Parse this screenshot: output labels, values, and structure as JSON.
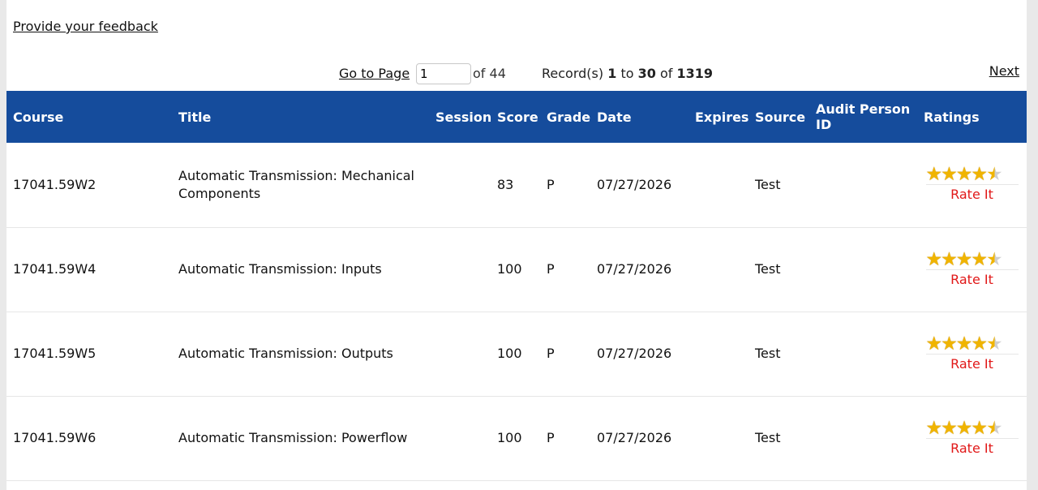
{
  "feedback_link": "Provide your feedback",
  "pager": {
    "goto_label": "Go to Page",
    "page_value": "1",
    "of_pages": "of 44",
    "records_prefix": "Record(s)",
    "records_start": "1",
    "records_to": "to",
    "records_end": "30",
    "records_of": "of",
    "records_total": "1319",
    "next_label": "Next"
  },
  "table": {
    "headers": [
      "Course",
      "Title",
      "Session",
      "Score",
      "Grade",
      "Date",
      "Expires",
      "Source",
      "Audit Person ID",
      "Ratings"
    ],
    "rows": [
      {
        "course": "17041.59W2",
        "title": "Automatic Transmission: Mechanical Components",
        "session": "",
        "score": "83",
        "grade": "P",
        "date": "07/27/2026",
        "expires": "",
        "source": "Test",
        "audit": "",
        "rating": 4.5,
        "rate_label": "Rate It"
      },
      {
        "course": "17041.59W4",
        "title": "Automatic Transmission: Inputs",
        "session": "",
        "score": "100",
        "grade": "P",
        "date": "07/27/2026",
        "expires": "",
        "source": "Test",
        "audit": "",
        "rating": 4.5,
        "rate_label": "Rate It"
      },
      {
        "course": "17041.59W5",
        "title": "Automatic Transmission: Outputs",
        "session": "",
        "score": "100",
        "grade": "P",
        "date": "07/27/2026",
        "expires": "",
        "source": "Test",
        "audit": "",
        "rating": 4.5,
        "rate_label": "Rate It"
      },
      {
        "course": "17041.59W6",
        "title": "Automatic Transmission: Powerflow",
        "session": "",
        "score": "100",
        "grade": "P",
        "date": "07/27/2026",
        "expires": "",
        "source": "Test",
        "audit": "",
        "rating": 4.5,
        "rate_label": "Rate It"
      }
    ]
  },
  "colors": {
    "header_bg": "#154c9c",
    "rate_link": "#e11818",
    "star": "#f0b400"
  }
}
